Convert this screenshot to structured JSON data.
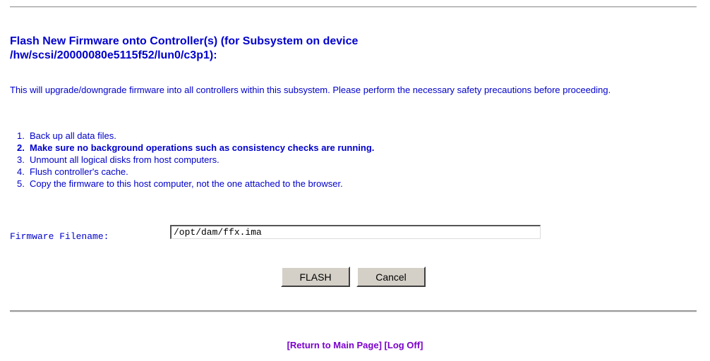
{
  "heading": {
    "line1": "Flash New Firmware onto Controller(s) (for Subsystem on device",
    "line2": "/hw/scsi/20000080e5115f52/lun0/c3p1):"
  },
  "intro": "This will upgrade/downgrade firmware into all controllers within this subsystem. Please perform the necessary safety precautions before proceeding.",
  "steps": [
    {
      "num": "1.",
      "text": "Back up all data files."
    },
    {
      "num": "2.",
      "text": "Make sure no background operations such as consistency checks are running."
    },
    {
      "num": "3.",
      "text": "Unmount all logical disks from host computers."
    },
    {
      "num": "4.",
      "text": "Flush controller's cache."
    },
    {
      "num": "5.",
      "text": "Copy the firmware to this host computer, not the one attached to the browser."
    }
  ],
  "firmware": {
    "label": "Firmware Filename:",
    "value": "/opt/dam/ffx.ima"
  },
  "buttons": {
    "flash": "FLASH",
    "cancel": "Cancel"
  },
  "footer": {
    "return_link": "[Return to Main Page]",
    "logoff_link": "[Log Off]"
  },
  "colors": {
    "text": "#0000cc",
    "link": "#7a00cc",
    "button_face": "#d4d0c8"
  }
}
